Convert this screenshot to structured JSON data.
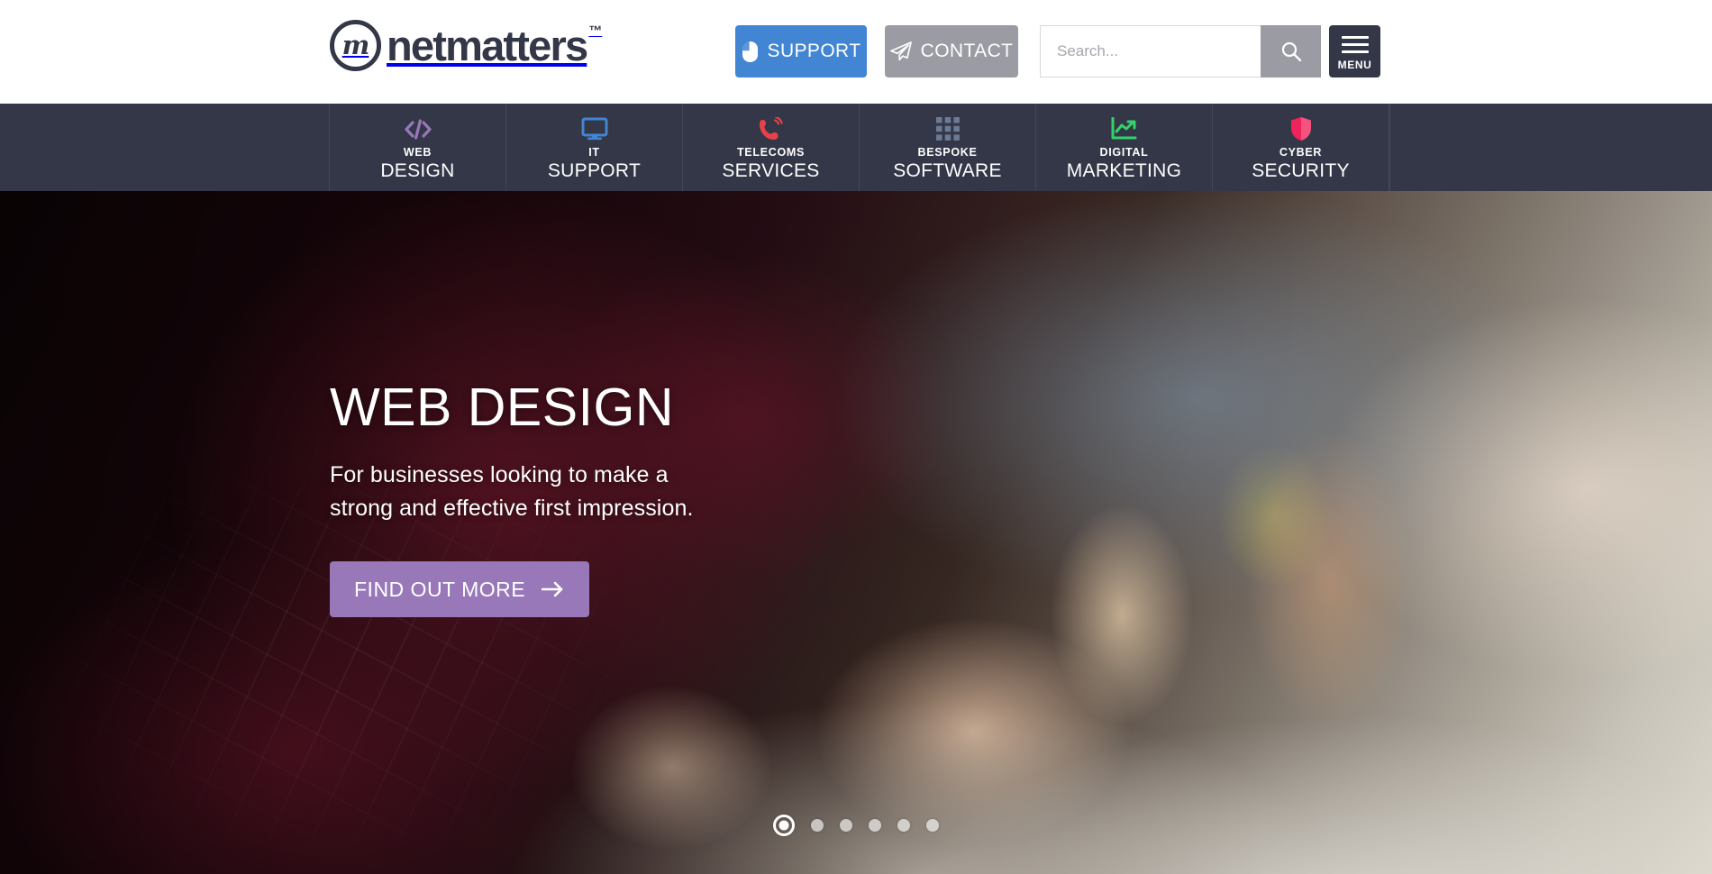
{
  "header": {
    "logo": {
      "mark_letter": "m",
      "name": "netmatters",
      "trademark": "™"
    },
    "support_button": {
      "label": "SUPPORT",
      "icon": "mouse-icon",
      "color": "#4285d2"
    },
    "contact_button": {
      "label": "CONTACT",
      "icon": "paper-plane-icon",
      "color": "#9b9ba3"
    },
    "search": {
      "value": "",
      "placeholder": "Search...",
      "button_icon": "search-icon"
    },
    "menu_button": {
      "label": "MENU",
      "icon": "hamburger-icon",
      "color": "#333747"
    }
  },
  "nav": {
    "background": "#333747",
    "items": [
      {
        "top": "WEB",
        "bottom": "DESIGN",
        "icon": "code-icon",
        "icon_color": "#9878b8"
      },
      {
        "top": "IT",
        "bottom": "SUPPORT",
        "icon": "monitor-icon",
        "icon_color": "#4285d2"
      },
      {
        "top": "TELECOMS",
        "bottom": "SERVICES",
        "icon": "phone-ring-icon",
        "icon_color": "#e8414a"
      },
      {
        "top": "BESPOKE",
        "bottom": "SOFTWARE",
        "icon": "grid-icon",
        "icon_color": "#6c7a94"
      },
      {
        "top": "DIGITAL",
        "bottom": "MARKETING",
        "icon": "chart-up-icon",
        "icon_color": "#32d46a"
      },
      {
        "top": "CYBER",
        "bottom": "SECURITY",
        "icon": "shield-icon",
        "icon_color": "#f0235a"
      }
    ]
  },
  "hero": {
    "title": "WEB DESIGN",
    "subtitle": "For businesses looking to make a strong and effective first impression.",
    "cta": {
      "label": "FIND OUT MORE",
      "icon": "arrow-right-icon",
      "color": "#9878b8"
    },
    "carousel": {
      "total": 6,
      "active_index": 0
    }
  }
}
